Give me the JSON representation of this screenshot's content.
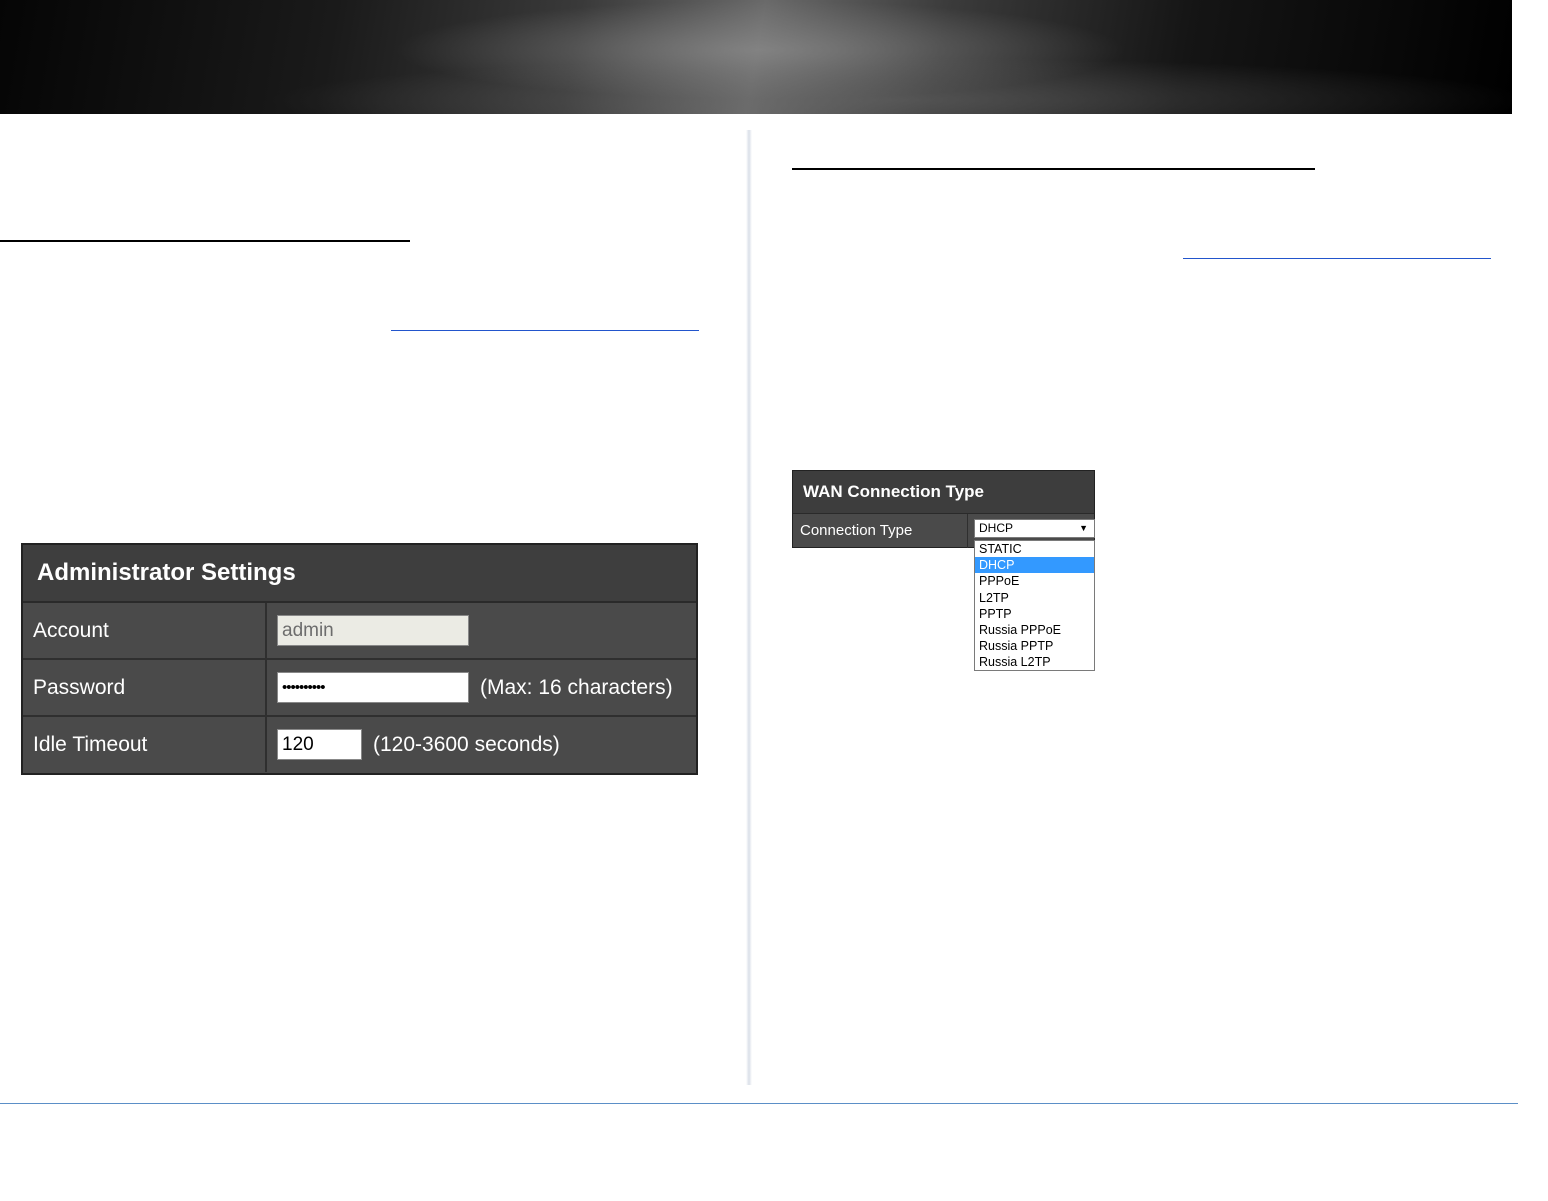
{
  "admin_settings": {
    "title": "Administrator Settings",
    "rows": [
      {
        "label": "Account",
        "value": "admin",
        "hint": ""
      },
      {
        "label": "Password",
        "value": "••••••••••",
        "hint": "(Max: 16 characters)"
      },
      {
        "label": "Idle Timeout",
        "value": "120",
        "hint": "(120-3600 seconds)"
      }
    ]
  },
  "wan_connection": {
    "title": "WAN Connection Type",
    "field_label": "Connection Type",
    "selected_value": "DHCP",
    "arrow": "▼",
    "options": [
      "STATIC",
      "DHCP",
      "PPPoE",
      "L2TP",
      "PPTP",
      "Russia PPPoE",
      "Russia PPTP",
      "Russia L2TP"
    ]
  },
  "colors": {
    "panel_bg": "#4a4a4a",
    "panel_header": "#3e3e3e",
    "highlight": "#3399ff",
    "footer_line": "#5b8fc7",
    "link": "#2255cc"
  }
}
